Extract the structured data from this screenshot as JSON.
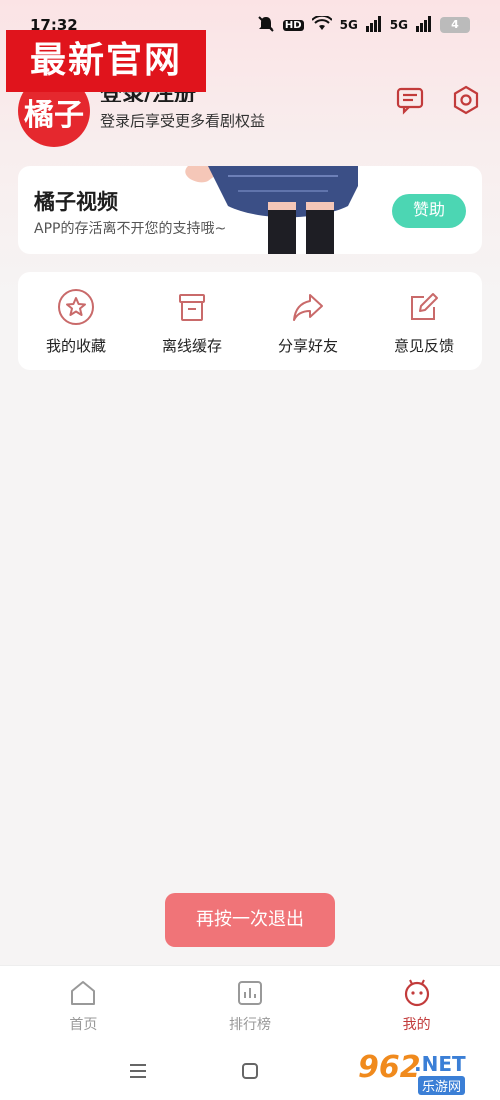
{
  "status_bar": {
    "time": "17:32",
    "hd_label": "HD",
    "signal_5g": "5G",
    "battery": "4"
  },
  "watermark": {
    "text": "最新官网"
  },
  "user": {
    "avatar_text": "橘子",
    "login_title": "登录/注册",
    "login_subtitle": "登录后享受更多看剧权益",
    "icons": [
      "message-icon",
      "settings-icon"
    ]
  },
  "sponsor": {
    "title": "橘子视频",
    "description": "APP的存活离不开您的支持哦~",
    "button_label": "赞助"
  },
  "actions": [
    {
      "label": "我的收藏",
      "icon": "star-icon"
    },
    {
      "label": "离线缓存",
      "icon": "cache-icon"
    },
    {
      "label": "分享好友",
      "icon": "share-icon"
    },
    {
      "label": "意见反馈",
      "icon": "feedback-icon"
    }
  ],
  "toast": {
    "text": "再按一次退出"
  },
  "bottom_nav": [
    {
      "label": "首页",
      "icon": "home-icon",
      "active": false
    },
    {
      "label": "排行榜",
      "icon": "ranking-icon",
      "active": false
    },
    {
      "label": "我的",
      "icon": "mine-icon",
      "active": true
    }
  ],
  "logo": {
    "number": "962",
    "suffix": ".NET",
    "site": "乐游网"
  },
  "colors": {
    "accent": "#c23b3b",
    "sponsor_button": "#4cd6b3",
    "toast": "#f07478",
    "avatar": "#e5282e"
  }
}
